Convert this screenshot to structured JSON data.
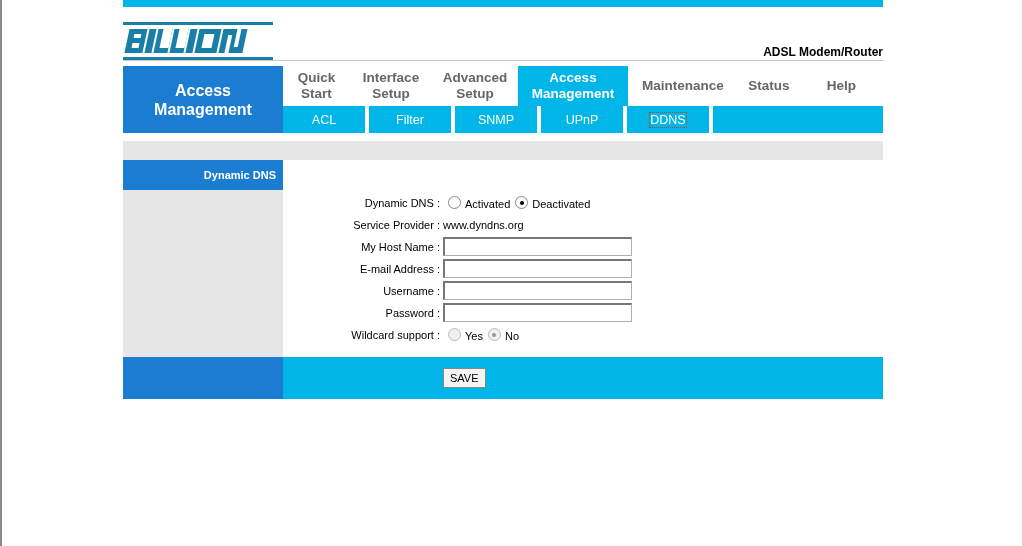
{
  "header": {
    "subtitle": "ADSL Modem/Router"
  },
  "section_title": "Access Management",
  "tabs": [
    {
      "label": "Quick Start",
      "selected": false
    },
    {
      "label": "Interface Setup",
      "selected": false
    },
    {
      "label": "Advanced Setup",
      "selected": false
    },
    {
      "label": "Access Management",
      "selected": true
    },
    {
      "label": "Maintenance",
      "selected": false
    },
    {
      "label": "Status",
      "selected": false
    },
    {
      "label": "Help",
      "selected": false
    }
  ],
  "subtabs": [
    {
      "label": "ACL",
      "selected": false
    },
    {
      "label": "Filter",
      "selected": false
    },
    {
      "label": "SNMP",
      "selected": false
    },
    {
      "label": "UPnP",
      "selected": false
    },
    {
      "label": "DDNS",
      "selected": true
    }
  ],
  "sidebar": {
    "title": "Dynamic DNS"
  },
  "form": [
    {
      "kind": "radio",
      "label": "Dynamic DNS :",
      "disabled": false,
      "options": [
        {
          "label": "Activated",
          "selected": false
        },
        {
          "label": "Deactivated",
          "selected": true
        }
      ]
    },
    {
      "kind": "text",
      "label": "Service Provider :",
      "value": "www.dyndns.org"
    },
    {
      "kind": "input",
      "label": "My Host Name :"
    },
    {
      "kind": "input",
      "label": "E-mail Address :"
    },
    {
      "kind": "input",
      "label": "Username :"
    },
    {
      "kind": "password",
      "label": "Password :"
    },
    {
      "kind": "radio",
      "label": "Wildcard support :",
      "disabled": true,
      "options": [
        {
          "label": "Yes",
          "selected": false
        },
        {
          "label": "No",
          "selected": true
        }
      ]
    }
  ],
  "save_button": "SAVE"
}
